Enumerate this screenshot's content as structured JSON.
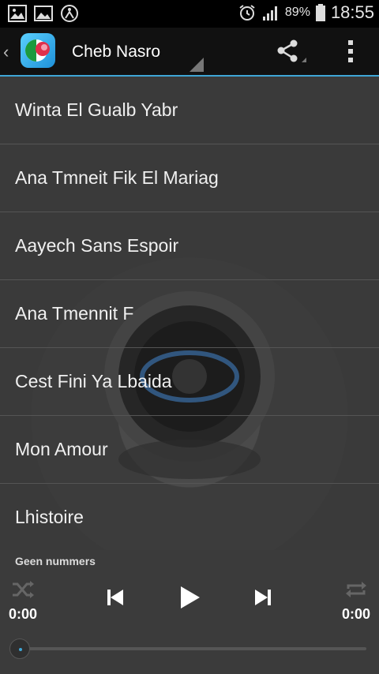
{
  "status_bar": {
    "battery_percent": "89%",
    "time": "18:55",
    "icons": [
      "gallery-notification-icon",
      "image-notification-icon",
      "accessibility-icon",
      "alarm-icon",
      "signal-icon",
      "battery-icon"
    ]
  },
  "action_bar": {
    "title": "Cheb Nasro",
    "icons": [
      "back-chevron-icon",
      "app-logo",
      "share-icon",
      "overflow-menu-icon"
    ]
  },
  "songs": [
    "Winta El Gualb Yabr",
    "Ana Tmneit Fik El Mariag",
    "Aayech Sans Espoir",
    "Ana Tmennit F",
    "Cest Fini Ya Lbaida",
    "Mon Amour",
    "Lhistoire"
  ],
  "player": {
    "status_text": "Geen nummers",
    "time_elapsed": "0:00",
    "time_total": "0:00",
    "progress": 0,
    "controls": [
      "shuffle-icon",
      "previous-icon",
      "play-icon",
      "next-icon",
      "repeat-icon"
    ]
  },
  "colors": {
    "accent": "#3fa6d6",
    "action_bar_bg": "#111111",
    "list_bg": "#3a3a3a"
  }
}
